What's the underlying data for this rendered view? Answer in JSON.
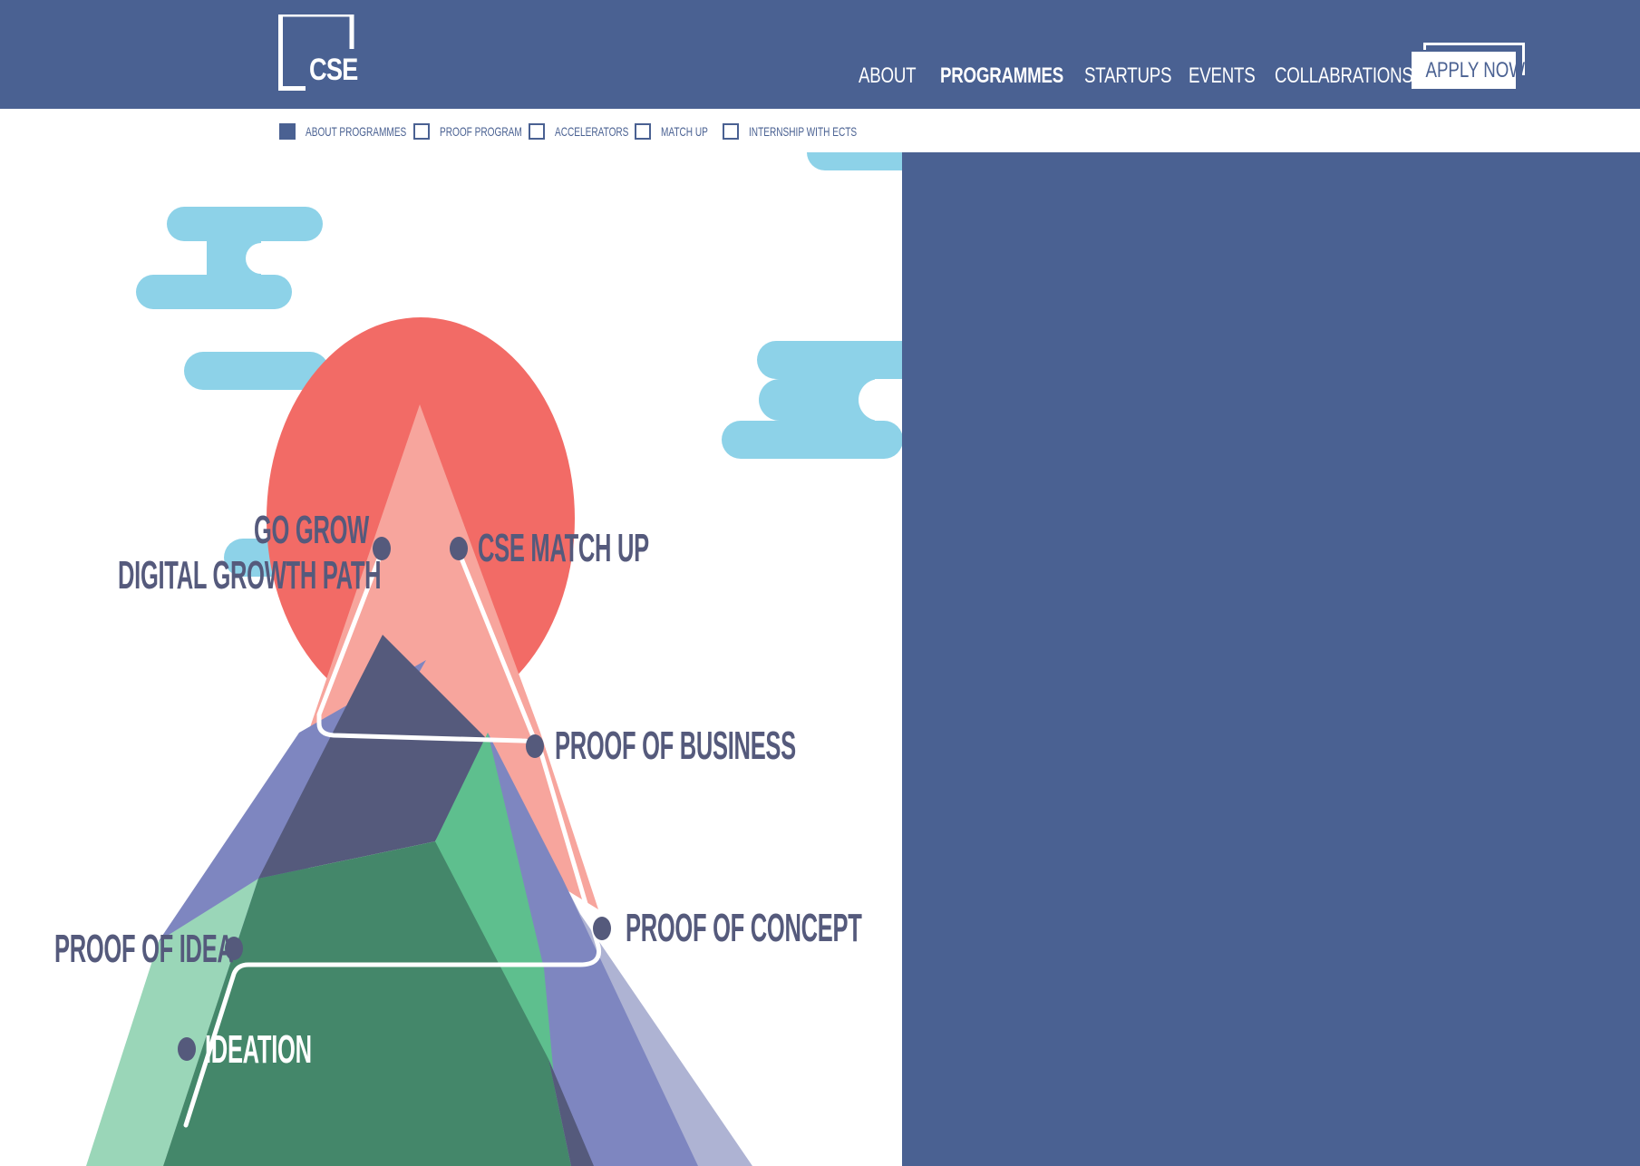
{
  "brand": {
    "logo_text": "CSE",
    "header_color": "#4a6192"
  },
  "nav": {
    "items": [
      {
        "label": "ABOUT",
        "active": false
      },
      {
        "label": "PROGRAMMES",
        "active": true
      },
      {
        "label": "STARTUPS",
        "active": false
      },
      {
        "label": "EVENTS",
        "active": false
      },
      {
        "label": "COLLABRATIONS",
        "active": false
      }
    ],
    "apply_label": "APPLY NOW"
  },
  "subnav": {
    "items": [
      {
        "label": "ABOUT PROGRAMMES",
        "selected": true
      },
      {
        "label": "PROOF PROGRAM",
        "selected": false
      },
      {
        "label": "ACCELERATORS",
        "selected": false
      },
      {
        "label": "MATCH UP",
        "selected": false
      },
      {
        "label": "INTERNSHIP WITH ECTS",
        "selected": false
      }
    ]
  },
  "journey": {
    "stages": {
      "go_grow": "GO GROW",
      "digital_growth_path": "DIGITAL GROWTH PATH",
      "cse_match_up": "CSE MATCH UP",
      "proof_of_business": "PROOF OF BUSINESS",
      "proof_of_concept": "PROOF OF CONCEPT",
      "proof_of_idea": "PROOF OF IDEA",
      "ideation": "IDEATION"
    },
    "colors": {
      "sun": "#f26b66",
      "sky_cloud": "#8dd2e8",
      "label": "#555a7c",
      "dot": "#555a7c"
    }
  }
}
